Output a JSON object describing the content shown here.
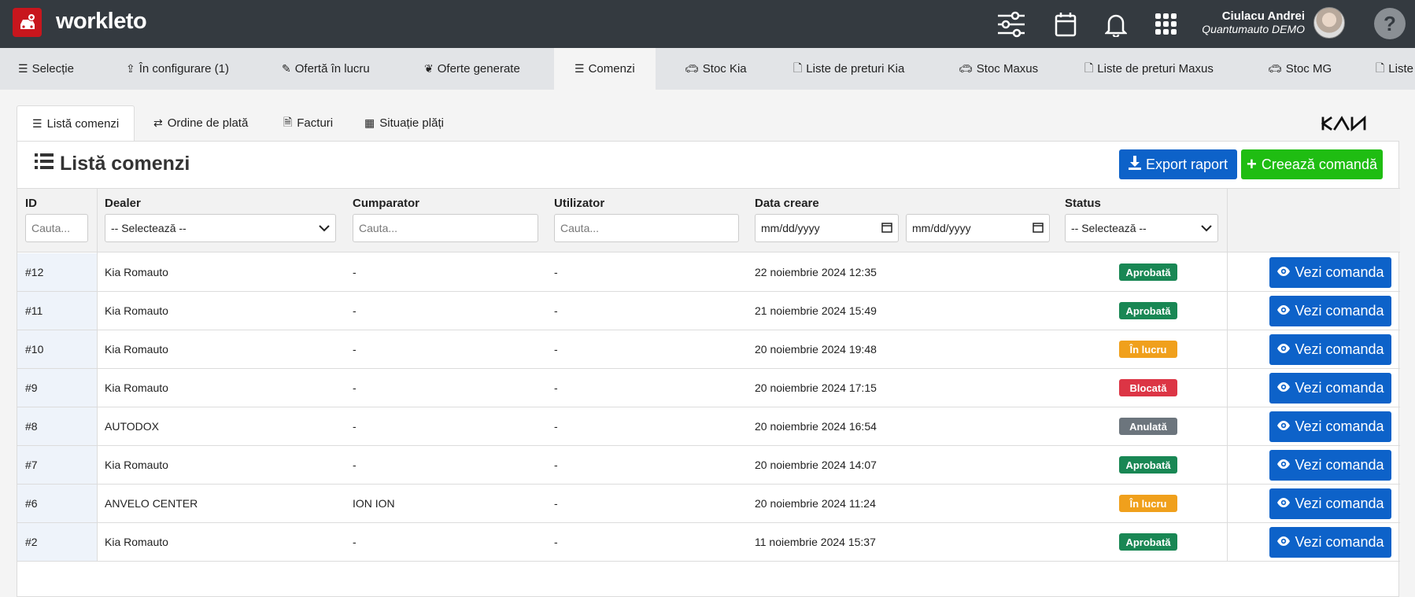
{
  "app": {
    "brand": "workleto"
  },
  "user": {
    "name": "Ciulacu Andrei",
    "company": "Quantumauto DEMO"
  },
  "help_label": "?",
  "nav": {
    "tabs": [
      {
        "label": "Selecție",
        "icon": "list-icon"
      },
      {
        "label": "În configurare (1)",
        "icon": "upload-icon"
      },
      {
        "label": "Ofertă în lucru",
        "icon": "edit-icon"
      },
      {
        "label": "Oferte generate",
        "icon": "paw-icon"
      },
      {
        "label": "Comenzi",
        "icon": "list-icon",
        "active": true
      },
      {
        "label": "Stoc Kia",
        "icon": "car-icon"
      },
      {
        "label": "Liste de preturi Kia",
        "icon": "file-icon"
      },
      {
        "label": "Stoc Maxus",
        "icon": "car-icon"
      },
      {
        "label": "Liste de preturi Maxus",
        "icon": "file-icon"
      },
      {
        "label": "Stoc MG",
        "icon": "car-icon"
      },
      {
        "label": "Liste",
        "icon": "file-icon"
      }
    ]
  },
  "subtabs": [
    {
      "label": "Listă comenzi",
      "active": true
    },
    {
      "label": "Ordine de plată"
    },
    {
      "label": "Facturi"
    },
    {
      "label": "Situație plăți"
    }
  ],
  "brand_logo_text": "KIA",
  "panel": {
    "title": "Listă comenzi",
    "export_label": "Export raport",
    "create_label": "Creează comandă"
  },
  "table": {
    "headers": {
      "id": "ID",
      "dealer": "Dealer",
      "buyer": "Cumparator",
      "user": "Utilizator",
      "created": "Data creare",
      "status": "Status"
    },
    "filters": {
      "search_placeholder": "Cauta...",
      "select_placeholder": "-- Selectează --",
      "date_placeholder": "mm/dd/yyyy"
    },
    "view_label": "Vezi comanda",
    "rows": [
      {
        "id": "#12",
        "dealer": "Kia Romauto",
        "buyer": "-",
        "user": "-",
        "created": "22 noiembrie 2024 12:35",
        "status": "Aprobată",
        "status_color": "#198754"
      },
      {
        "id": "#11",
        "dealer": "Kia Romauto",
        "buyer": "-",
        "user": "-",
        "created": "21 noiembrie 2024 15:49",
        "status": "Aprobată",
        "status_color": "#198754"
      },
      {
        "id": "#10",
        "dealer": "Kia Romauto",
        "buyer": "-",
        "user": "-",
        "created": "20 noiembrie 2024 19:48",
        "status": "În lucru",
        "status_color": "#f0a01c"
      },
      {
        "id": "#9",
        "dealer": "Kia Romauto",
        "buyer": "-",
        "user": "-",
        "created": "20 noiembrie 2024 17:15",
        "status": "Blocată",
        "status_color": "#dc3545"
      },
      {
        "id": "#8",
        "dealer": "AUTODOX",
        "buyer": "-",
        "user": "-",
        "created": "20 noiembrie 2024 16:54",
        "status": "Anulată",
        "status_color": "#6c757d"
      },
      {
        "id": "#7",
        "dealer": "Kia Romauto",
        "buyer": "-",
        "user": "-",
        "created": "20 noiembrie 2024 14:07",
        "status": "Aprobată",
        "status_color": "#198754"
      },
      {
        "id": "#6",
        "dealer": "ANVELO CENTER",
        "buyer": "ION ION",
        "user": "-",
        "created": "20 noiembrie 2024 11:24",
        "status": "În lucru",
        "status_color": "#f0a01c"
      },
      {
        "id": "#2",
        "dealer": "Kia Romauto",
        "buyer": "-",
        "user": "-",
        "created": "11 noiembrie 2024 15:37",
        "status": "Aprobată",
        "status_color": "#198754"
      }
    ]
  },
  "colors": {
    "topbar": "#343a40",
    "primary": "#0d62c9",
    "success": "#1fbd12",
    "logo": "#c8161d"
  }
}
